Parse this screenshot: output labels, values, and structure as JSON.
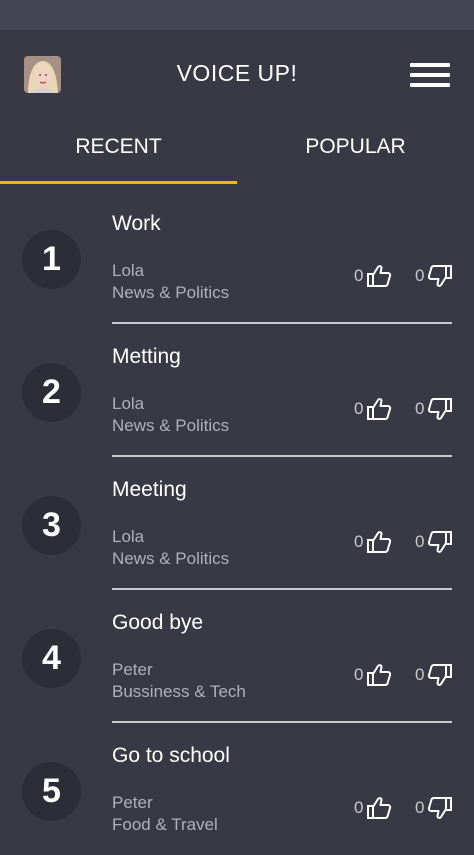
{
  "app": {
    "title": "VOICE UP!"
  },
  "tabs": [
    {
      "label": "RECENT",
      "active": true
    },
    {
      "label": "POPULAR",
      "active": false
    }
  ],
  "colors": {
    "background": "#383944",
    "accent": "#f0b90f",
    "rank_circle": "#2c2d36",
    "secondary_text": "#b0b1b8"
  },
  "icons": {
    "menu": "hamburger-menu-icon",
    "like": "thumbs-up-icon",
    "dislike": "thumbs-down-icon"
  },
  "items": [
    {
      "rank": "1",
      "title": "Work",
      "author": "Lola",
      "category": "News & Politics",
      "likes": "0",
      "dislikes": "0"
    },
    {
      "rank": "2",
      "title": "Metting",
      "author": "Lola",
      "category": "News & Politics",
      "likes": "0",
      "dislikes": "0"
    },
    {
      "rank": "3",
      "title": "Meeting",
      "author": "Lola",
      "category": "News & Politics",
      "likes": "0",
      "dislikes": "0"
    },
    {
      "rank": "4",
      "title": "Good bye",
      "author": "Peter",
      "category": "Bussiness & Tech",
      "likes": "0",
      "dislikes": "0"
    },
    {
      "rank": "5",
      "title": "Go to school",
      "author": "Peter",
      "category": "Food & Travel",
      "likes": "0",
      "dislikes": "0"
    }
  ]
}
